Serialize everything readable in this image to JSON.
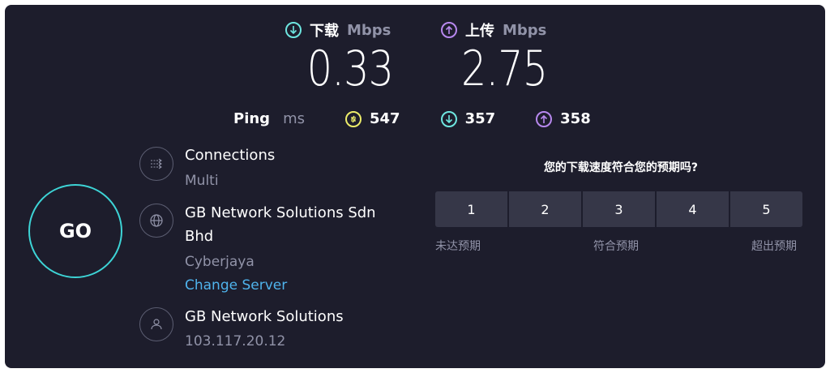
{
  "download": {
    "label": "下载",
    "unit": "Mbps",
    "value": "0.33"
  },
  "upload": {
    "label": "上传",
    "unit": "Mbps",
    "value": "2.75"
  },
  "ping": {
    "label": "Ping",
    "unit": "ms",
    "idle": "547",
    "down": "357",
    "up": "358"
  },
  "go_label": "GO",
  "connections": {
    "title": "Connections",
    "value": "Multi"
  },
  "server": {
    "name_line1": "GB Network Solutions Sdn",
    "name_line2": "Bhd",
    "location": "Cyberjaya",
    "change_link": "Change Server"
  },
  "provider": {
    "name": "GB Network Solutions",
    "ip": "103.117.20.12"
  },
  "rating": {
    "question": "您的下载速度符合您的预期吗?",
    "options": [
      "1",
      "2",
      "3",
      "4",
      "5"
    ],
    "label_low": "未达预期",
    "label_mid": "符合预期",
    "label_high": "超出预期"
  },
  "colors": {
    "download": "#6ee6e0",
    "upload": "#b788ee",
    "ping": "#eded6a",
    "go_ring": "#3dd4d6",
    "link": "#4fb3ec"
  }
}
